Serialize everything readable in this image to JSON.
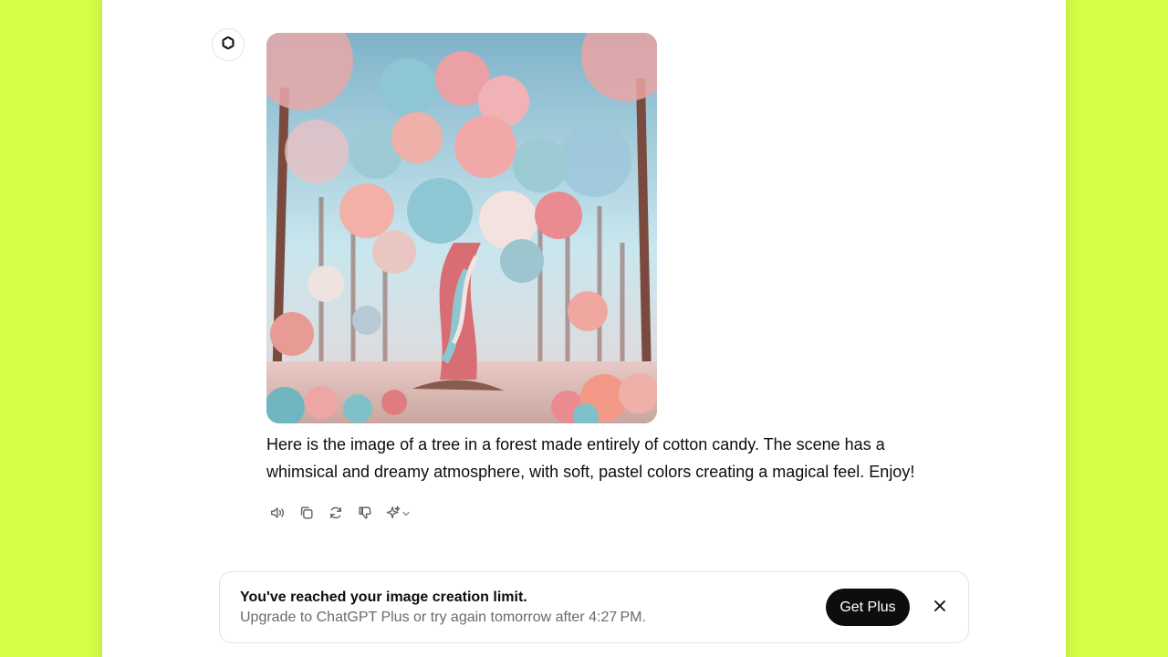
{
  "conversation": {
    "assistant_icon": "openai-logo-icon",
    "generated_image": {
      "subject": "cotton-candy-tree-forest"
    },
    "message_text": "Here is the image of a tree in a forest made entirely of cotton candy. The scene has a whimsical and dreamy atmosphere, with soft, pastel colors creating a magical feel. Enjoy!",
    "actions": [
      {
        "icon": "read-aloud-icon"
      },
      {
        "icon": "copy-icon"
      },
      {
        "icon": "regenerate-icon"
      },
      {
        "icon": "thumbs-down-icon"
      },
      {
        "icon": "sparkle-model-icon"
      }
    ]
  },
  "limit_banner": {
    "title": "You've reached your image creation limit.",
    "subtitle": "Upgrade to ChatGPT Plus or try again tomorrow after 4:27 PM.",
    "cta_label": "Get Plus",
    "close_icon": "close-icon"
  },
  "colors": {
    "page_background": "#d4ff47",
    "window_background": "#ffffff",
    "button_background": "#0d0d0d",
    "muted_text": "#6b6b6b"
  }
}
